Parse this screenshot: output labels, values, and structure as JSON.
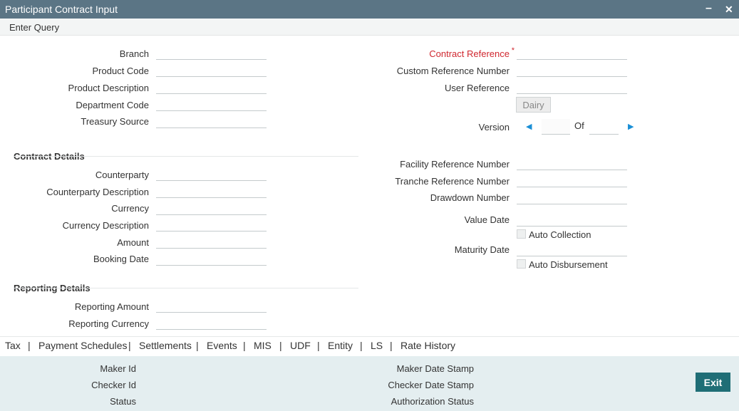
{
  "window": {
    "title": "Participant Contract Input",
    "minimize": "–",
    "close": "✕"
  },
  "menu": {
    "enter_query": "Enter Query"
  },
  "header_left": {
    "branch": "Branch",
    "product_code": "Product Code",
    "product_description": "Product Description",
    "department_code": "Department Code",
    "treasury_source": "Treasury Source"
  },
  "header_right": {
    "contract_reference": "Contract Reference",
    "required_mark": "*",
    "custom_reference_number": "Custom Reference Number",
    "user_reference": "User Reference",
    "dairy_button": "Dairy",
    "version": "Version",
    "of": "Of"
  },
  "contract_details": {
    "title": "Contract Details",
    "counterparty": "Counterparty",
    "counterparty_description": "Counterparty Description",
    "currency": "Currency",
    "currency_description": "Currency Description",
    "amount": "Amount",
    "booking_date": "Booking Date"
  },
  "right_details": {
    "facility_reference_number": "Facility Reference Number",
    "tranche_reference_number": "Tranche Reference Number",
    "drawdown_number": "Drawdown Number",
    "value_date": "Value Date",
    "auto_collection": "Auto Collection",
    "maturity_date": "Maturity Date",
    "auto_disbursement": "Auto Disbursement"
  },
  "reporting_details": {
    "title": "Reporting Details",
    "reporting_amount": "Reporting Amount",
    "reporting_currency": "Reporting Currency"
  },
  "tabs": [
    "Tax",
    "Payment Schedules",
    "Settlements",
    "Events",
    "MIS",
    "UDF",
    "Entity",
    "LS",
    "Rate History"
  ],
  "tab_separator": "|",
  "footer": {
    "maker_id": "Maker Id",
    "checker_id": "Checker Id",
    "status": "Status",
    "maker_date_stamp": "Maker Date Stamp",
    "checker_date_stamp": "Checker Date Stamp",
    "authorization_status": "Authorization Status",
    "exit_button": "Exit"
  },
  "colors": {
    "titlebar": "#5b7585",
    "required": "#d0272f",
    "accent": "#1a8fd6",
    "footer_bg": "#e4eef0",
    "exit_button": "#1f6e76"
  }
}
